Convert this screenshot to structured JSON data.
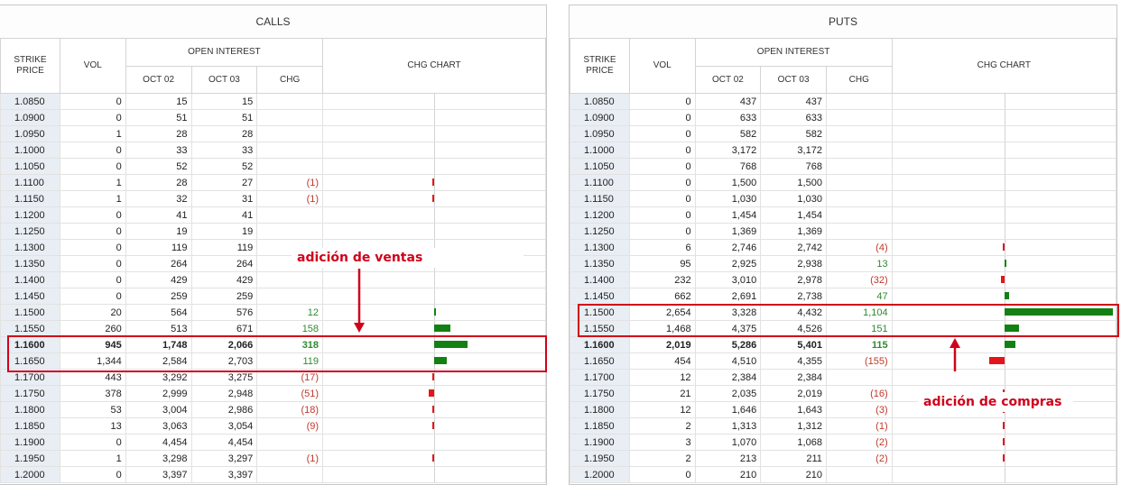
{
  "colors": {
    "positive_bar": "#138013",
    "negative_bar": "#e3151a",
    "highlight": "#d0021b"
  },
  "headers": {
    "strike": "STRIKE PRICE",
    "vol": "VOL",
    "open_interest": "OPEN INTEREST",
    "oct02": "OCT 02",
    "oct03": "OCT 03",
    "chg": "CHG",
    "chg_chart": "CHG CHART"
  },
  "calls": {
    "title": "CALLS",
    "rows": [
      {
        "strike": "1.0850",
        "vol": "0",
        "oct02": "15",
        "oct03": "15",
        "chg": "",
        "chg_value": 0
      },
      {
        "strike": "1.0900",
        "vol": "0",
        "oct02": "51",
        "oct03": "51",
        "chg": "",
        "chg_value": 0
      },
      {
        "strike": "1.0950",
        "vol": "1",
        "oct02": "28",
        "oct03": "28",
        "chg": "",
        "chg_value": 0
      },
      {
        "strike": "1.1000",
        "vol": "0",
        "oct02": "33",
        "oct03": "33",
        "chg": "",
        "chg_value": 0
      },
      {
        "strike": "1.1050",
        "vol": "0",
        "oct02": "52",
        "oct03": "52",
        "chg": "",
        "chg_value": 0
      },
      {
        "strike": "1.1100",
        "vol": "1",
        "oct02": "28",
        "oct03": "27",
        "chg": "(1)",
        "chg_value": -1
      },
      {
        "strike": "1.1150",
        "vol": "1",
        "oct02": "32",
        "oct03": "31",
        "chg": "(1)",
        "chg_value": -1
      },
      {
        "strike": "1.1200",
        "vol": "0",
        "oct02": "41",
        "oct03": "41",
        "chg": "",
        "chg_value": 0
      },
      {
        "strike": "1.1250",
        "vol": "0",
        "oct02": "19",
        "oct03": "19",
        "chg": "",
        "chg_value": 0
      },
      {
        "strike": "1.1300",
        "vol": "0",
        "oct02": "119",
        "oct03": "119",
        "chg": "",
        "chg_value": 0
      },
      {
        "strike": "1.1350",
        "vol": "0",
        "oct02": "264",
        "oct03": "264",
        "chg": "",
        "chg_value": 0
      },
      {
        "strike": "1.1400",
        "vol": "0",
        "oct02": "429",
        "oct03": "429",
        "chg": "",
        "chg_value": 0
      },
      {
        "strike": "1.1450",
        "vol": "0",
        "oct02": "259",
        "oct03": "259",
        "chg": "",
        "chg_value": 0
      },
      {
        "strike": "1.1500",
        "vol": "20",
        "oct02": "564",
        "oct03": "576",
        "chg": "12",
        "chg_value": 12
      },
      {
        "strike": "1.1550",
        "vol": "260",
        "oct02": "513",
        "oct03": "671",
        "chg": "158",
        "chg_value": 158
      },
      {
        "strike": "1.1600",
        "vol": "945",
        "oct02": "1,748",
        "oct03": "2,066",
        "chg": "318",
        "chg_value": 318,
        "bold": true
      },
      {
        "strike": "1.1650",
        "vol": "1,344",
        "oct02": "2,584",
        "oct03": "2,703",
        "chg": "119",
        "chg_value": 119
      },
      {
        "strike": "1.1700",
        "vol": "443",
        "oct02": "3,292",
        "oct03": "3,275",
        "chg": "(17)",
        "chg_value": -17
      },
      {
        "strike": "1.1750",
        "vol": "378",
        "oct02": "2,999",
        "oct03": "2,948",
        "chg": "(51)",
        "chg_value": -51
      },
      {
        "strike": "1.1800",
        "vol": "53",
        "oct02": "3,004",
        "oct03": "2,986",
        "chg": "(18)",
        "chg_value": -18
      },
      {
        "strike": "1.1850",
        "vol": "13",
        "oct02": "3,063",
        "oct03": "3,054",
        "chg": "(9)",
        "chg_value": -9
      },
      {
        "strike": "1.1900",
        "vol": "0",
        "oct02": "4,454",
        "oct03": "4,454",
        "chg": "",
        "chg_value": 0
      },
      {
        "strike": "1.1950",
        "vol": "1",
        "oct02": "3,298",
        "oct03": "3,297",
        "chg": "(1)",
        "chg_value": -1
      },
      {
        "strike": "1.2000",
        "vol": "0",
        "oct02": "3,397",
        "oct03": "3,397",
        "chg": "",
        "chg_value": 0
      }
    ]
  },
  "puts": {
    "title": "PUTS",
    "rows": [
      {
        "strike": "1.0850",
        "vol": "0",
        "oct02": "437",
        "oct03": "437",
        "chg": "",
        "chg_value": 0
      },
      {
        "strike": "1.0900",
        "vol": "0",
        "oct02": "633",
        "oct03": "633",
        "chg": "",
        "chg_value": 0
      },
      {
        "strike": "1.0950",
        "vol": "0",
        "oct02": "582",
        "oct03": "582",
        "chg": "",
        "chg_value": 0
      },
      {
        "strike": "1.1000",
        "vol": "0",
        "oct02": "3,172",
        "oct03": "3,172",
        "chg": "",
        "chg_value": 0
      },
      {
        "strike": "1.1050",
        "vol": "0",
        "oct02": "768",
        "oct03": "768",
        "chg": "",
        "chg_value": 0
      },
      {
        "strike": "1.1100",
        "vol": "0",
        "oct02": "1,500",
        "oct03": "1,500",
        "chg": "",
        "chg_value": 0
      },
      {
        "strike": "1.1150",
        "vol": "0",
        "oct02": "1,030",
        "oct03": "1,030",
        "chg": "",
        "chg_value": 0
      },
      {
        "strike": "1.1200",
        "vol": "0",
        "oct02": "1,454",
        "oct03": "1,454",
        "chg": "",
        "chg_value": 0
      },
      {
        "strike": "1.1250",
        "vol": "0",
        "oct02": "1,369",
        "oct03": "1,369",
        "chg": "",
        "chg_value": 0
      },
      {
        "strike": "1.1300",
        "vol": "6",
        "oct02": "2,746",
        "oct03": "2,742",
        "chg": "(4)",
        "chg_value": -4
      },
      {
        "strike": "1.1350",
        "vol": "95",
        "oct02": "2,925",
        "oct03": "2,938",
        "chg": "13",
        "chg_value": 13
      },
      {
        "strike": "1.1400",
        "vol": "232",
        "oct02": "3,010",
        "oct03": "2,978",
        "chg": "(32)",
        "chg_value": -32
      },
      {
        "strike": "1.1450",
        "vol": "662",
        "oct02": "2,691",
        "oct03": "2,738",
        "chg": "47",
        "chg_value": 47
      },
      {
        "strike": "1.1500",
        "vol": "2,654",
        "oct02": "3,328",
        "oct03": "4,432",
        "chg": "1,104",
        "chg_value": 1104
      },
      {
        "strike": "1.1550",
        "vol": "1,468",
        "oct02": "4,375",
        "oct03": "4,526",
        "chg": "151",
        "chg_value": 151
      },
      {
        "strike": "1.1600",
        "vol": "2,019",
        "oct02": "5,286",
        "oct03": "5,401",
        "chg": "115",
        "chg_value": 115,
        "bold": true
      },
      {
        "strike": "1.1650",
        "vol": "454",
        "oct02": "4,510",
        "oct03": "4,355",
        "chg": "(155)",
        "chg_value": -155
      },
      {
        "strike": "1.1700",
        "vol": "12",
        "oct02": "2,384",
        "oct03": "2,384",
        "chg": "",
        "chg_value": 0
      },
      {
        "strike": "1.1750",
        "vol": "21",
        "oct02": "2,035",
        "oct03": "2,019",
        "chg": "(16)",
        "chg_value": -16
      },
      {
        "strike": "1.1800",
        "vol": "12",
        "oct02": "1,646",
        "oct03": "1,643",
        "chg": "(3)",
        "chg_value": -3
      },
      {
        "strike": "1.1850",
        "vol": "2",
        "oct02": "1,313",
        "oct03": "1,312",
        "chg": "(1)",
        "chg_value": -1
      },
      {
        "strike": "1.1900",
        "vol": "3",
        "oct02": "1,070",
        "oct03": "1,068",
        "chg": "(2)",
        "chg_value": -2
      },
      {
        "strike": "1.1950",
        "vol": "2",
        "oct02": "213",
        "oct03": "211",
        "chg": "(2)",
        "chg_value": -2
      },
      {
        "strike": "1.2000",
        "vol": "0",
        "oct02": "210",
        "oct03": "210",
        "chg": "",
        "chg_value": 0
      }
    ]
  },
  "annotations": {
    "calls_note": "adición de ventas",
    "puts_note": "adición de compras"
  }
}
